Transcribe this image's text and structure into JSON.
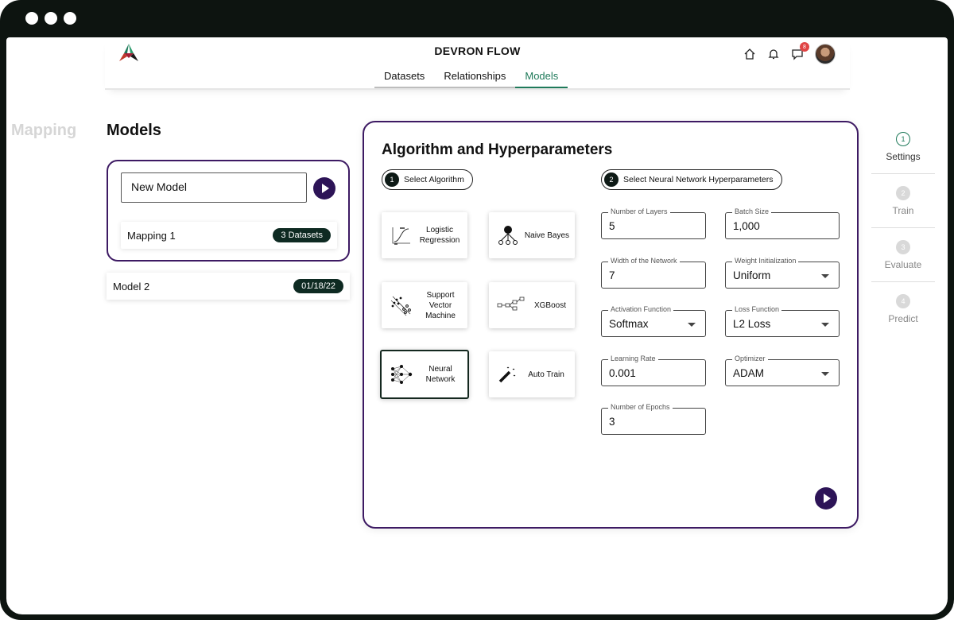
{
  "header": {
    "title": "DEVRON FLOW",
    "notification_count": "8",
    "tabs": [
      "Datasets",
      "Relationships",
      "Models"
    ],
    "active_tab": "Models"
  },
  "page": {
    "ghost_title": "Mapping",
    "title": "Models"
  },
  "models": {
    "new_model_value": "New Model",
    "mapping_name": "Mapping 1",
    "mapping_badge": "3 Datasets",
    "model2_name": "Model 2",
    "model2_date": "01/18/22"
  },
  "panel": {
    "title": "Algorithm and Hyperparameters",
    "step1": {
      "num": "1",
      "label": "Select Algorithm"
    },
    "step2": {
      "num": "2",
      "label": "Select Neural Network Hyperparameters"
    },
    "algorithms": [
      {
        "label": "Logistic Regression",
        "icon": "logistic-regression-icon"
      },
      {
        "label": "Naive Bayes",
        "icon": "naive-bayes-icon"
      },
      {
        "label": "Support Vector Machine",
        "icon": "svm-icon"
      },
      {
        "label": "XGBoost",
        "icon": "xgboost-icon"
      },
      {
        "label": "Neural Network",
        "icon": "neural-network-icon"
      },
      {
        "label": "Auto Train",
        "icon": "magic-wand-icon"
      }
    ],
    "selected_algorithm": "Neural Network",
    "fields": {
      "layers": {
        "label": "Number of Layers",
        "value": "5"
      },
      "batch": {
        "label": "Batch Size",
        "value": "1,000"
      },
      "width": {
        "label": "Width of the Network",
        "value": "7"
      },
      "weight_init": {
        "label": "Weight Initialization",
        "value": "Uniform"
      },
      "activation": {
        "label": "Activation Function",
        "value": "Softmax"
      },
      "loss": {
        "label": "Loss Function",
        "value": "L2 Loss"
      },
      "lr": {
        "label": "Learning Rate",
        "value": "0.001"
      },
      "optimizer": {
        "label": "Optimizer",
        "value": "ADAM"
      },
      "epochs": {
        "label": "Number of Epochs",
        "value": "3"
      }
    }
  },
  "steps": [
    {
      "num": "1",
      "label": "Settings",
      "active": true
    },
    {
      "num": "2",
      "label": "Train",
      "active": false
    },
    {
      "num": "3",
      "label": "Evaluate",
      "active": false
    },
    {
      "num": "4",
      "label": "Predict",
      "active": false
    }
  ],
  "colors": {
    "accent_green": "#1f7a5a",
    "brand_purple": "#3d1a63",
    "badge_red": "#e04545"
  }
}
